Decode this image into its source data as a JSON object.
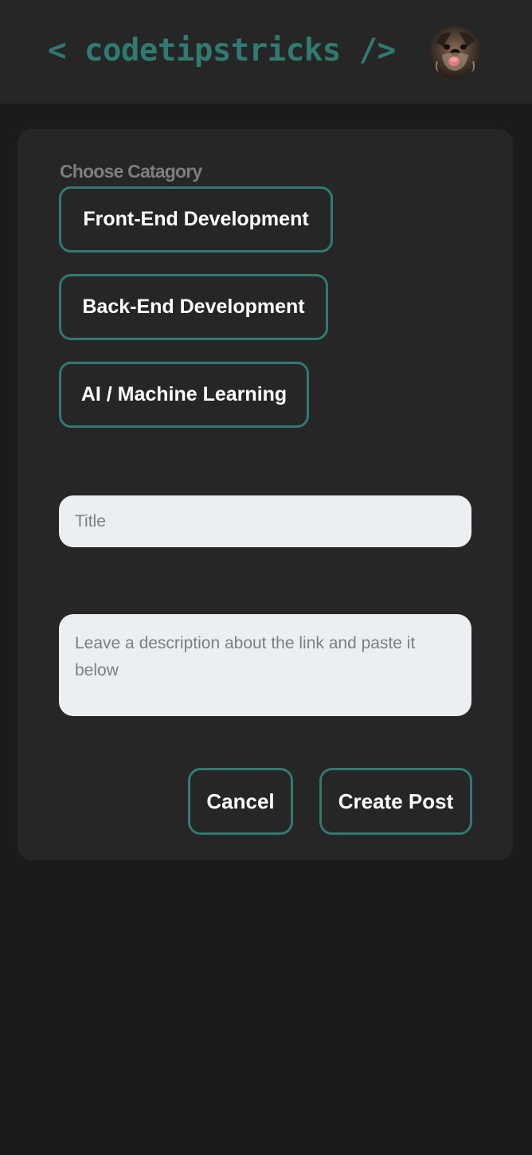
{
  "header": {
    "logo_text": "< codetipstricks />",
    "avatar_icon": "user-avatar-dog-photo"
  },
  "form": {
    "category_label": "Choose Catagory",
    "categories": [
      {
        "label": "Front-End Development"
      },
      {
        "label": "Back-End Development"
      },
      {
        "label": "AI / Machine Learning"
      }
    ],
    "title": {
      "value": "",
      "placeholder": "Title"
    },
    "description": {
      "value": "",
      "placeholder": "Leave a description about the link and paste it below"
    },
    "cancel_label": "Cancel",
    "create_label": "Create Post"
  },
  "colors": {
    "background": "#1b1b1b",
    "panel": "#262626",
    "accent": "#2f7a71",
    "input_bg": "#eceff2",
    "muted_label": "#7d7d7d"
  }
}
